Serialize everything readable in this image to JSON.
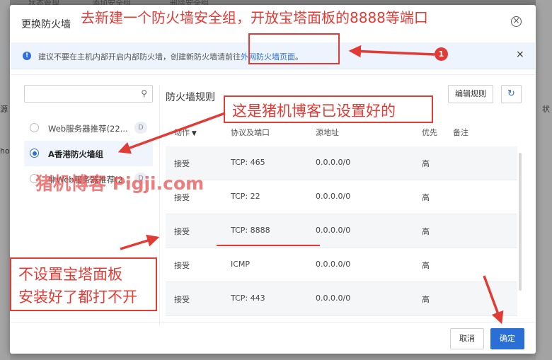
{
  "background": {
    "tabs": [
      "状态管理",
      "添加安全组",
      "删除安全组"
    ],
    "left_snippets": [
      "源",
      "hos"
    ],
    "right_snippets": [
      "状"
    ]
  },
  "dialog": {
    "title": "更换防火墙",
    "notice": {
      "text": "建议不要在主机内部开启内部防火墙，创建新防火墙请前往",
      "link": "外网防火墙页面",
      "end": "。"
    },
    "search": {
      "placeholder": ""
    },
    "groups": [
      {
        "label": "Web服务器推荐(22...",
        "badge": "D",
        "selected": false
      },
      {
        "label": "A香港防火墙组",
        "badge": "",
        "selected": true
      },
      {
        "label": "非Web服务器推荐(2...",
        "badge": "D",
        "selected": false
      }
    ],
    "rules_title": "防火墙规则",
    "edit_label": "编辑规则",
    "columns": [
      "动作",
      "协议及端口",
      "源地址",
      "优先",
      "备注"
    ],
    "rows": [
      {
        "action": "接受",
        "port": "TCP: 465",
        "source": "0.0.0.0/0",
        "priority": "高",
        "note": ""
      },
      {
        "action": "接受",
        "port": "TCP: 22",
        "source": "0.0.0.0/0",
        "priority": "高",
        "note": ""
      },
      {
        "action": "接受",
        "port": "TCP: 8888",
        "source": "0.0.0.0/0",
        "priority": "高",
        "note": ""
      },
      {
        "action": "接受",
        "port": "ICMP",
        "source": "0.0.0.0/0",
        "priority": "高",
        "note": ""
      },
      {
        "action": "接受",
        "port": "TCP: 443",
        "source": "0.0.0.0/0",
        "priority": "高",
        "note": ""
      }
    ],
    "cancel_label": "取消",
    "ok_label": "确定"
  },
  "annotations": {
    "top": "去新建一个防火墙安全组，开放宝塔面板的8888等端口",
    "middle": "这是猪机博客已设置好的",
    "bottom_line1": "不设置宝塔面板",
    "bottom_line2": "安装好了都打不开",
    "badge": "1",
    "watermark": "猪机博客 Pigji.com",
    "color": "#e23b35"
  }
}
